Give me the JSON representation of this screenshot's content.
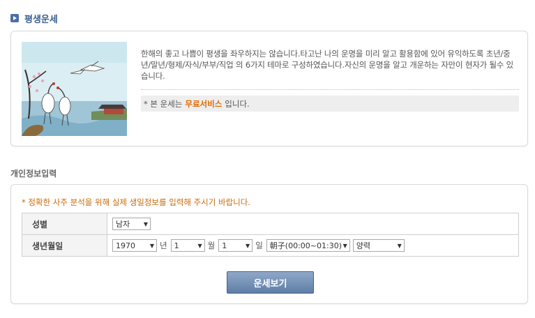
{
  "header": {
    "title": "평생운세",
    "icon": "play-icon"
  },
  "intro": {
    "illustration": "cranes-pavilion-illustration",
    "description": "한해의 좋고 나쁨이 평생을 좌우하지는 않습니다.타고난 나의 운명을 미리 알고 활용함에 있어 유익하도록 초년/중년/말년/형제/자식/부부/직업 의 6가지 테마로 구성하였습니다.자신의 운명을 알고 개운하는 자만이 현자가 될수 있습니다.",
    "note_prefix": "* 본 운세는",
    "note_highlight": "무료서비스",
    "note_suffix": "입니다."
  },
  "personal": {
    "title": "개인정보입력",
    "warning": "* 정확한 사주 분석을 위해 실제 생일정보를 입력해 주시기 바랍니다.",
    "gender": {
      "label": "성별",
      "value": "남자"
    },
    "birth": {
      "label": "생년월일",
      "year": "1970",
      "year_unit": "년",
      "month": "1",
      "month_unit": "월",
      "day": "1",
      "day_unit": "일",
      "time": "朝子(00:00~01:30)",
      "calendar": "양력"
    },
    "submit_label": "운세보기"
  },
  "colors": {
    "title": "#3a5f8f",
    "warning": "#c96a08",
    "highlight": "#e06b00",
    "button": "#6a87b0"
  }
}
